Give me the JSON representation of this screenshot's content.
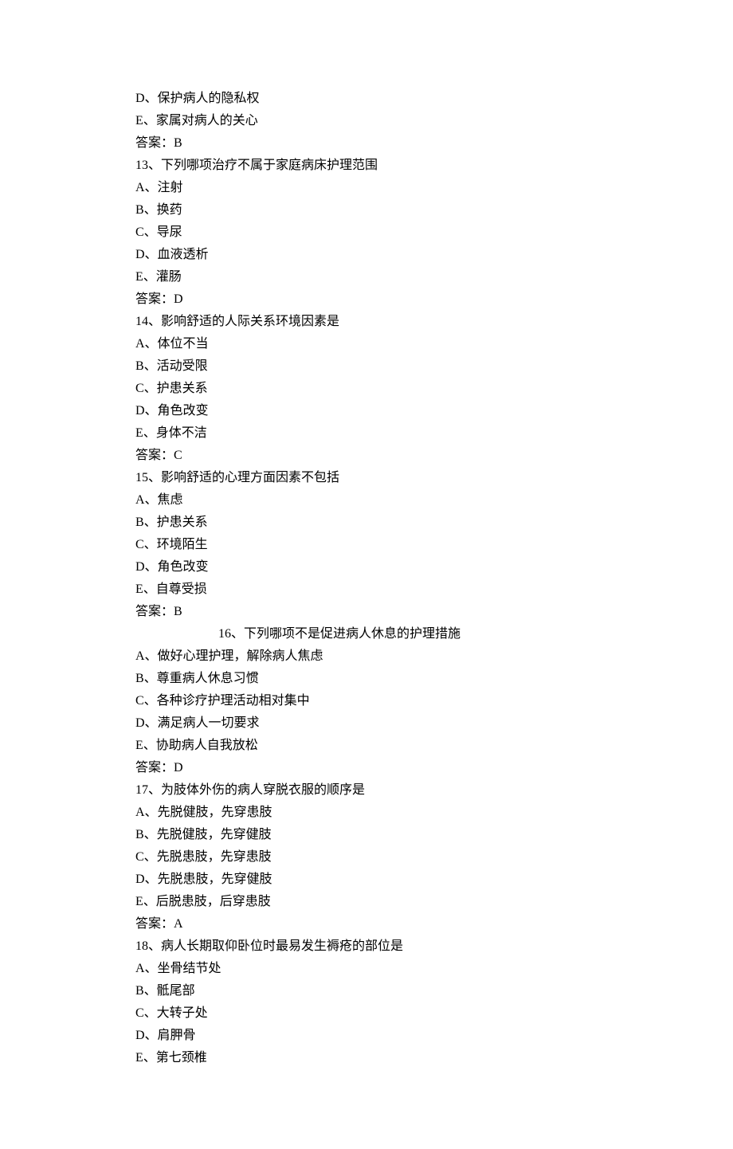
{
  "q12_tail": {
    "options": [
      "D、保护病人的隐私权",
      "E、家属对病人的关心"
    ],
    "answer": "答案：B"
  },
  "q13": {
    "stem": "13、下列哪项治疗不属于家庭病床护理范围",
    "options": [
      "A、注射",
      "B、换药",
      "C、导尿",
      "D、血液透析",
      "E、灌肠"
    ],
    "answer": "答案：D"
  },
  "q14": {
    "stem": "14、影响舒适的人际关系环境因素是",
    "options": [
      "A、体位不当",
      "B、活动受限",
      "C、护患关系",
      "D、角色改变",
      "E、身体不洁"
    ],
    "answer": "答案：C"
  },
  "q15": {
    "stem": "15、影响舒适的心理方面因素不包括",
    "options": [
      "A、焦虑",
      "B、护患关系",
      "C、环境陌生",
      "D、角色改变",
      "E、自尊受损"
    ],
    "answer": "答案：B"
  },
  "q16": {
    "stem": "16、下列哪项不是促进病人休息的护理措施",
    "options": [
      "A、做好心理护理，解除病人焦虑",
      "B、尊重病人休息习惯",
      "C、各种诊疗护理活动相对集中",
      "D、满足病人一切要求",
      "E、协助病人自我放松"
    ],
    "answer": "答案：D"
  },
  "q17": {
    "stem": "17、为肢体外伤的病人穿脱衣服的顺序是",
    "options": [
      "A、先脱健肢，先穿患肢",
      "B、先脱健肢，先穿健肢",
      "C、先脱患肢，先穿患肢",
      "D、先脱患肢，先穿健肢",
      "E、后脱患肢，后穿患肢"
    ],
    "answer": "答案：A"
  },
  "q18": {
    "stem": "18、病人长期取仰卧位时最易发生褥疮的部位是",
    "options": [
      "A、坐骨结节处",
      "B、骶尾部",
      "C、大转子处",
      "D、肩胛骨",
      "E、第七颈椎"
    ]
  }
}
